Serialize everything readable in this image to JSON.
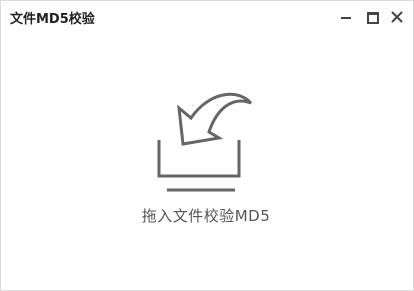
{
  "window": {
    "title": "文件MD5校验"
  },
  "titlebar_buttons": {
    "minimize_icon": "minimize-icon",
    "maximize_icon": "maximize-icon",
    "close_icon": "close-icon"
  },
  "drop_zone": {
    "icon": "drop-into-tray-arrow-icon",
    "label": "拖入文件校验MD5"
  },
  "colors": {
    "icon": "#666666",
    "label": "#555555",
    "title": "#222222",
    "border": "#dcdcdc"
  }
}
